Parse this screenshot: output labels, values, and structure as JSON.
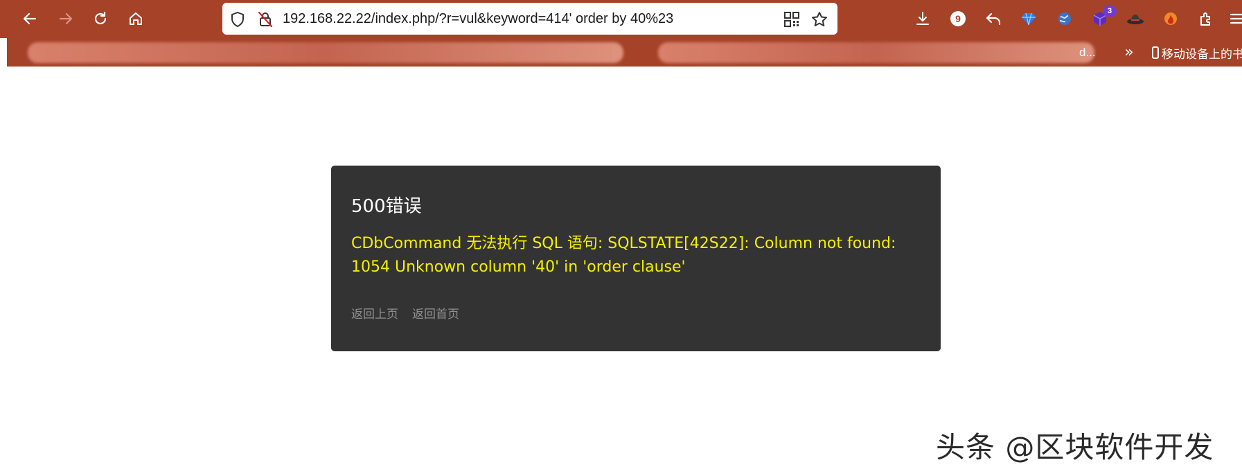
{
  "browser": {
    "url": "192.168.22.22/index.php/?r=vul&keyword=414' order by 40%23",
    "notification_count": "9",
    "extension_badge": "3",
    "bookmarks": {
      "overflow_glyph": "»",
      "truncated_item": "d...",
      "mobile_bookmarks_label": "移动设备上的书"
    }
  },
  "error": {
    "title": "500错误",
    "message": "CDbCommand 无法执行 SQL 语句: SQLSTATE[42S22]: Column not found: 1054 Unknown column '40' in 'order clause'",
    "links": {
      "back": "返回上页",
      "home": "返回首页"
    }
  },
  "watermark": "头条 @区块软件开发",
  "colors": {
    "chrome": "#a54228",
    "error_panel": "#333333",
    "error_message": "#f5f000",
    "link": "#8f8f8f"
  },
  "icons": [
    "back-icon",
    "forward-icon",
    "reload-icon",
    "home-icon",
    "shield-icon",
    "insecure-lock-icon",
    "qr-code-icon",
    "star-icon",
    "download-icon",
    "reply-icon",
    "diamond-extension-icon",
    "globe-extension-icon",
    "cube-extension-icon",
    "hat-extension-icon",
    "flame-extension-icon",
    "extensions-icon",
    "menu-icon"
  ]
}
